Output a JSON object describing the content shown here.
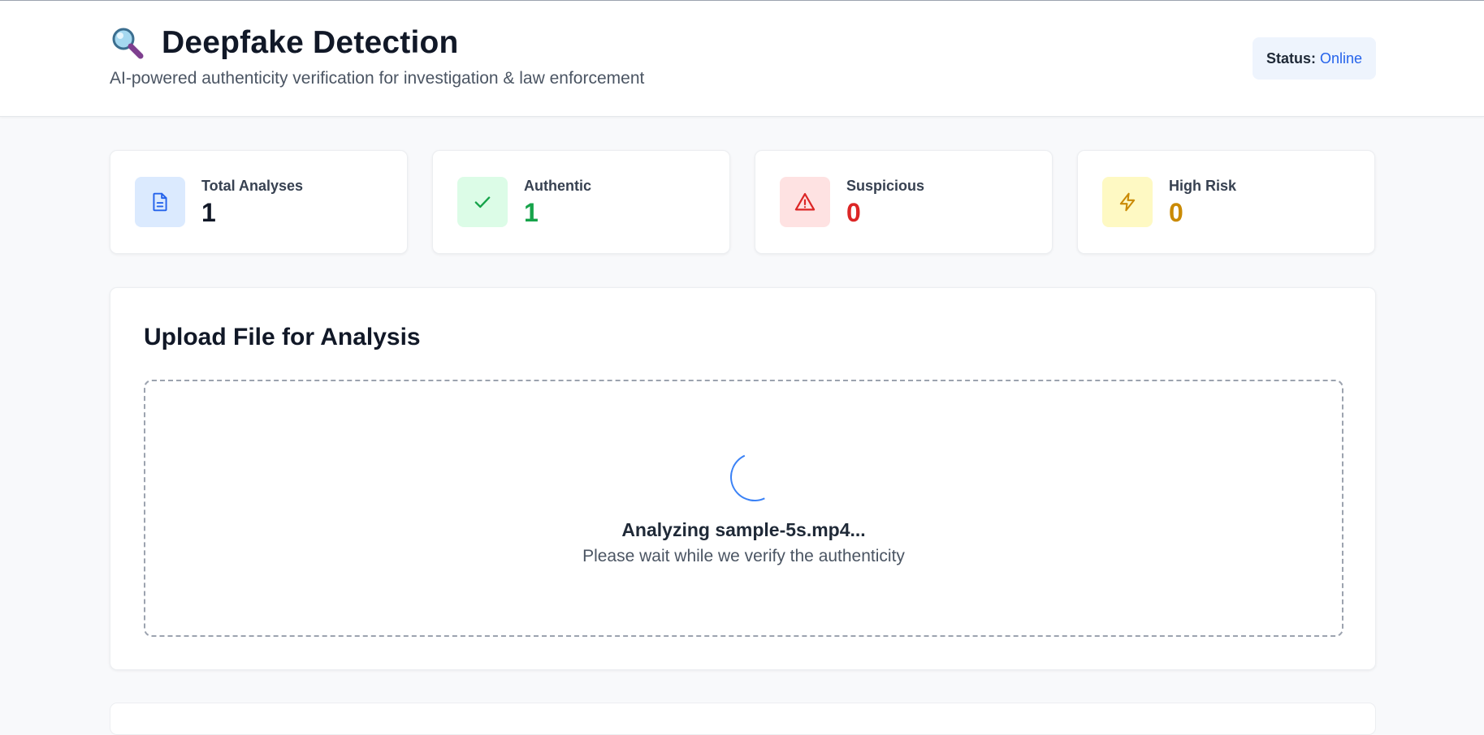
{
  "header": {
    "title": "Deepfake Detection",
    "subtitle": "AI-powered authenticity verification for investigation & law enforcement",
    "logo_icon": "magnifying-glass-icon",
    "status_label": "Status:",
    "status_value": "Online"
  },
  "stats": [
    {
      "label": "Total Analyses",
      "value": "1",
      "icon": "document-icon",
      "color": "#111827",
      "bg": "#dbeafe",
      "icon_color": "#2563eb"
    },
    {
      "label": "Authentic",
      "value": "1",
      "icon": "check-icon",
      "color": "#16a34a",
      "bg": "#dcfce7",
      "icon_color": "#16a34a"
    },
    {
      "label": "Suspicious",
      "value": "0",
      "icon": "warning-triangle-icon",
      "color": "#dc2626",
      "bg": "#fee2e2",
      "icon_color": "#dc2626"
    },
    {
      "label": "High Risk",
      "value": "0",
      "icon": "lightning-icon",
      "color": "#ca8a04",
      "bg": "#fef9c3",
      "icon_color": "#ca8a04"
    }
  ],
  "upload": {
    "title": "Upload File for Analysis",
    "analyzing_text": "Analyzing sample-5s.mp4...",
    "wait_text": "Please wait while we verify the authenticity"
  },
  "colors": {
    "accent": "#2563eb",
    "background": "#f8f9fb"
  }
}
